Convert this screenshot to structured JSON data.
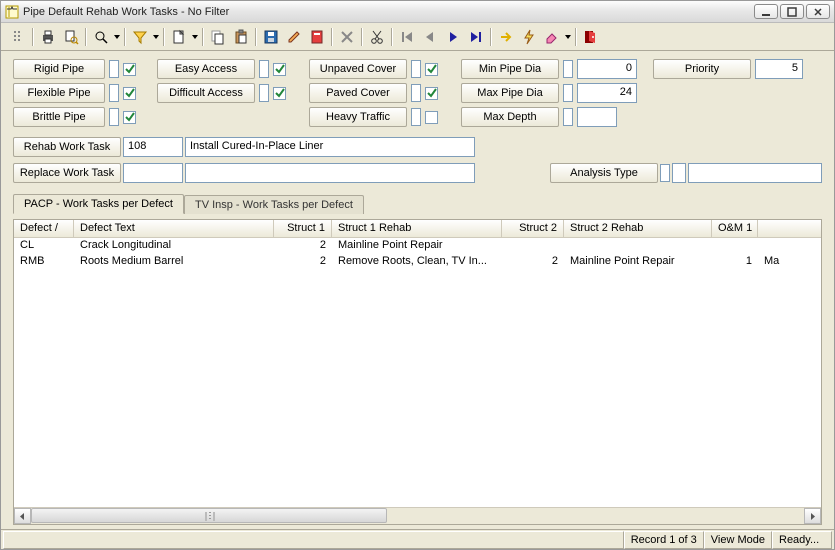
{
  "window": {
    "title": "Pipe Default Rehab Work Tasks - No Filter"
  },
  "criteria": {
    "rigid_pipe_label": "Rigid Pipe",
    "rigid_pipe_checked": true,
    "flexible_pipe_label": "Flexible Pipe",
    "flexible_pipe_checked": true,
    "brittle_pipe_label": "Brittle Pipe",
    "brittle_pipe_checked": true,
    "easy_access_label": "Easy Access",
    "easy_access_checked": true,
    "difficult_access_label": "Difficult Access",
    "difficult_access_checked": true,
    "unpaved_cover_label": "Unpaved Cover",
    "unpaved_cover_checked": true,
    "paved_cover_label": "Paved Cover",
    "paved_cover_checked": true,
    "heavy_traffic_label": "Heavy Traffic",
    "heavy_traffic_checked": false,
    "min_pipe_dia_label": "Min Pipe Dia",
    "min_pipe_dia_value": "0",
    "max_pipe_dia_label": "Max Pipe Dia",
    "max_pipe_dia_value": "24",
    "max_depth_label": "Max Depth",
    "max_depth_value": "",
    "priority_label": "Priority",
    "priority_value": "5"
  },
  "tasks": {
    "rehab_label": "Rehab Work Task",
    "rehab_code": "108",
    "rehab_desc": "Install Cured-In-Place Liner",
    "replace_label": "Replace Work Task",
    "replace_code": "",
    "replace_desc": "",
    "analysis_type_label": "Analysis Type",
    "analysis_type_code": "",
    "analysis_type_name": ""
  },
  "tabs": {
    "pacp": "PACP - Work Tasks per Defect",
    "tvinsp": "TV Insp - Work Tasks per Defect"
  },
  "grid": {
    "headers": {
      "defect": "Defect /",
      "defect_text": "Defect Text",
      "struct1": "Struct 1",
      "struct1_rehab": "Struct 1 Rehab",
      "struct2": "Struct 2",
      "struct2_rehab": "Struct 2 Rehab",
      "om1": "O&M 1",
      "extra": ""
    },
    "rows": [
      {
        "defect": "CL",
        "defect_text": "Crack Longitudinal",
        "struct1": "2",
        "struct1_rehab": "Mainline Point Repair",
        "struct2": "",
        "struct2_rehab": "",
        "om1": "",
        "extra": ""
      },
      {
        "defect": "RMB",
        "defect_text": "Roots Medium Barrel",
        "struct1": "2",
        "struct1_rehab": "Remove Roots, Clean, TV In...",
        "struct2": "2",
        "struct2_rehab": "Mainline Point Repair",
        "om1": "1",
        "extra": "Ma"
      }
    ]
  },
  "status": {
    "record": "Record 1 of 3",
    "mode": "View Mode",
    "ready": "Ready..."
  }
}
